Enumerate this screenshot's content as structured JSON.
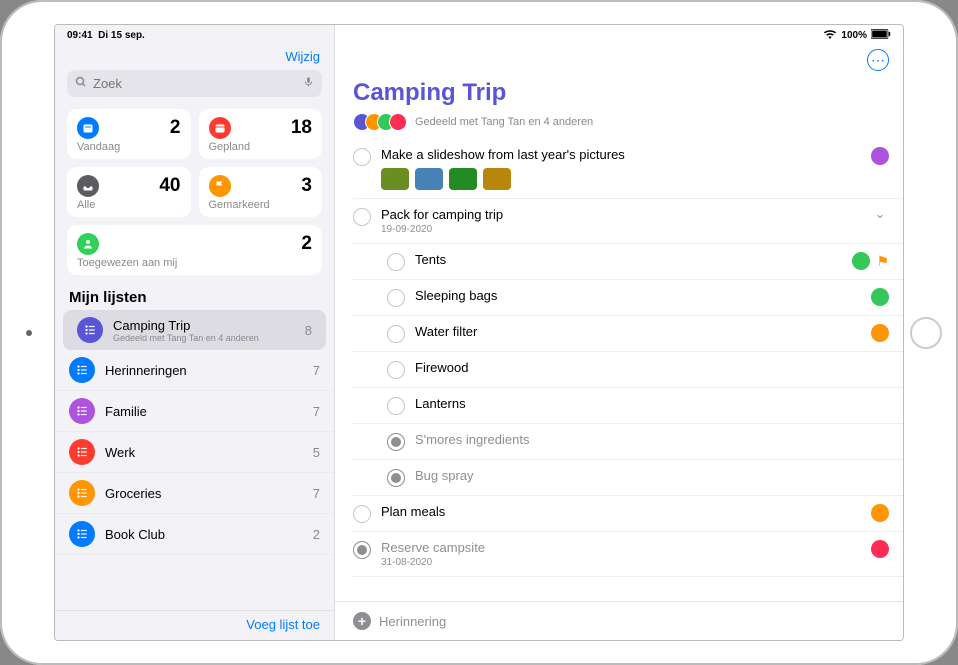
{
  "status": {
    "time": "09:41",
    "date": "Di 15 sep.",
    "wifi_icon": "wifi",
    "battery_pct": "100%"
  },
  "sidebar": {
    "edit_label": "Wijzig",
    "search_placeholder": "Zoek",
    "cards": {
      "today": {
        "label": "Vandaag",
        "count": "2",
        "color": "#007aff"
      },
      "planned": {
        "label": "Gepland",
        "count": "18",
        "color": "#ff3b30"
      },
      "all": {
        "label": "Alle",
        "count": "40",
        "color": "#5b5b60"
      },
      "flagged": {
        "label": "Gemarkeerd",
        "count": "3",
        "color": "#ff9500"
      },
      "assigned": {
        "label": "Toegewezen aan mij",
        "count": "2",
        "color": "#30d158"
      }
    },
    "section_title": "Mijn lijsten",
    "lists": [
      {
        "name": "Camping Trip",
        "sub": "Gedeeld met Tang Tan en 4 anderen",
        "count": "8",
        "color": "#5856d6",
        "selected": true
      },
      {
        "name": "Herinneringen",
        "sub": "",
        "count": "7",
        "color": "#007aff"
      },
      {
        "name": "Familie",
        "sub": "",
        "count": "7",
        "color": "#af52de"
      },
      {
        "name": "Werk",
        "sub": "",
        "count": "5",
        "color": "#ff3b30"
      },
      {
        "name": "Groceries",
        "sub": "",
        "count": "7",
        "color": "#ff9500"
      },
      {
        "name": "Book Club",
        "sub": "",
        "count": "2",
        "color": "#007aff"
      }
    ],
    "add_list_label": "Voeg lijst toe"
  },
  "main": {
    "title": "Camping Trip",
    "title_color": "#5856d6",
    "shared_text": "Gedeeld met Tang Tan en 4 anderen",
    "avatars": [
      "#5856d6",
      "#ff9500",
      "#34c759",
      "#ff2d55"
    ],
    "tasks": [
      {
        "title": "Make a slideshow from last year's pictures",
        "done": false,
        "assignee": "#af52de",
        "thumbs": [
          "#6b8e23",
          "#4682b4",
          "#228b22",
          "#b8860b"
        ]
      },
      {
        "title": "Pack for camping trip",
        "done": false,
        "date": "19-09-2020",
        "expandable": true,
        "subs": [
          {
            "title": "Tents",
            "done": false,
            "assignee": "#34c759",
            "flagged": true
          },
          {
            "title": "Sleeping bags",
            "done": false,
            "assignee": "#34c759"
          },
          {
            "title": "Water filter",
            "done": false,
            "assignee": "#ff9500"
          },
          {
            "title": "Firewood",
            "done": false
          },
          {
            "title": "Lanterns",
            "done": false
          },
          {
            "title": "S'mores ingredients",
            "done": true
          },
          {
            "title": "Bug spray",
            "done": true
          }
        ]
      },
      {
        "title": "Plan meals",
        "done": false,
        "assignee": "#ff9500"
      },
      {
        "title": "Reserve campsite",
        "done": true,
        "date": "31-08-2020",
        "assignee": "#ff2d55"
      }
    ],
    "add_reminder_label": "Herinnering"
  }
}
